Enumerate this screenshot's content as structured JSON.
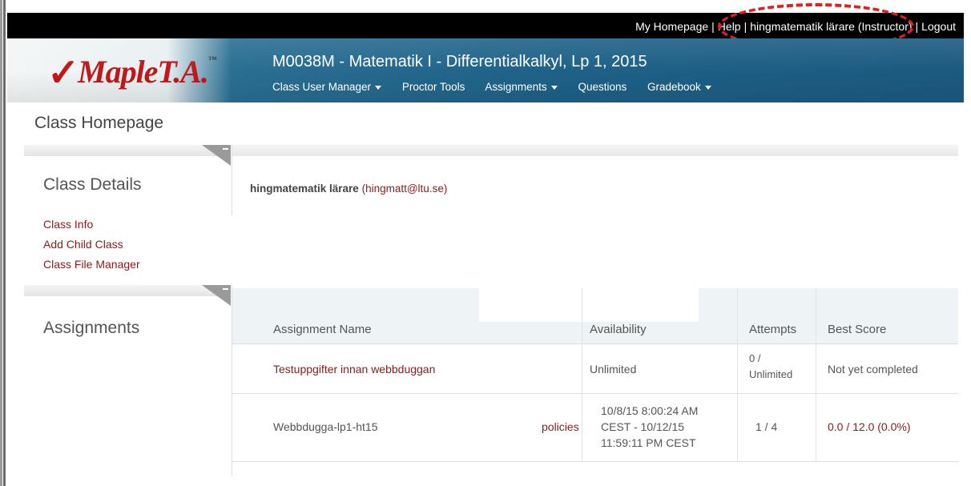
{
  "topbar": {
    "my_homepage": "My Homepage",
    "help": "Help",
    "user": "hingmatematik lärare (Instructor)",
    "logout": "Logout",
    "separator": "|"
  },
  "logo": {
    "check": "✓",
    "name": "MapleT.A.",
    "tm": "™"
  },
  "course": {
    "title": "M0038M - Matematik I - Differentialkalkyl, Lp 1, 2015"
  },
  "nav": {
    "items": [
      {
        "label": "Class User Manager",
        "dropdown": true
      },
      {
        "label": "Proctor Tools",
        "dropdown": false
      },
      {
        "label": "Assignments",
        "dropdown": true
      },
      {
        "label": "Questions",
        "dropdown": false
      },
      {
        "label": "Gradebook",
        "dropdown": true
      }
    ]
  },
  "page": {
    "title": "Class Homepage"
  },
  "class_details": {
    "title": "Class Details",
    "links": [
      "Class Info",
      "Add Child Class",
      "Class File Manager"
    ],
    "user_name": "hingmatematik lärare",
    "user_email": "hingmatt@ltu.se",
    "open_paren": "(",
    "close_paren": ")"
  },
  "assignments": {
    "title": "Assignments",
    "columns": [
      "Assignment Name",
      "Availability",
      "Attempts",
      "Best Score"
    ],
    "rows": [
      {
        "name": "Testuppgifter innan webbduggan",
        "policies": "",
        "availability": [
          "Unlimited"
        ],
        "attempts": [
          "0 /",
          "Unlimited"
        ],
        "best_score": "Not yet completed"
      },
      {
        "name": "Webbdugga-lp1-ht15",
        "policies": "policies",
        "availability": [
          "10/8/15 8:00:24 AM",
          "CEST - 10/12/15",
          "11:59:11 PM CEST"
        ],
        "attempts": [
          "1 / 4"
        ],
        "best_score": "0.0 / 12.0 (0.0%)"
      }
    ]
  },
  "colors": {
    "link_red": "#8c1a1a",
    "banner_blue": "#1e6188",
    "highlight": "#e02020"
  }
}
